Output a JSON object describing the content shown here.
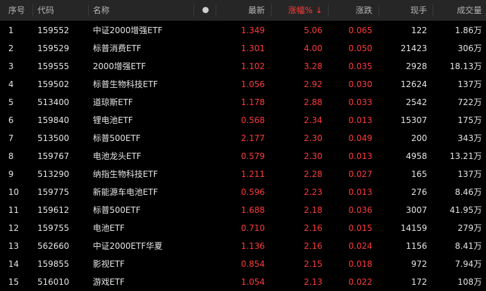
{
  "colors": {
    "header_bg": "#262626",
    "background": "#000000",
    "up": "#ff3b3b",
    "text": "#e6e6e6",
    "header_text": "#b4b4b4"
  },
  "header": {
    "index": "序号",
    "code": "代码",
    "name": "名称",
    "dot_icon": "circle-icon",
    "latest": "最新",
    "change_pct": "涨幅%",
    "sort_icon": "↓",
    "change": "涨跌",
    "volume_hand": "现手",
    "turnover": "成交量"
  },
  "rows": [
    {
      "index": "1",
      "code": "159552",
      "name": "中证2000增强ETF",
      "latest": "1.349",
      "pct": "5.06",
      "chg": "0.065",
      "hand": "122",
      "amount": "1.86万"
    },
    {
      "index": "2",
      "code": "159529",
      "name": "标普消费ETF",
      "latest": "1.301",
      "pct": "4.00",
      "chg": "0.050",
      "hand": "21423",
      "amount": "306万"
    },
    {
      "index": "3",
      "code": "159555",
      "name": "2000增强ETF",
      "latest": "1.102",
      "pct": "3.28",
      "chg": "0.035",
      "hand": "2928",
      "amount": "18.13万"
    },
    {
      "index": "4",
      "code": "159502",
      "name": "标普生物科技ETF",
      "latest": "1.056",
      "pct": "2.92",
      "chg": "0.030",
      "hand": "12624",
      "amount": "137万"
    },
    {
      "index": "5",
      "code": "513400",
      "name": "道琼斯ETF",
      "latest": "1.178",
      "pct": "2.88",
      "chg": "0.033",
      "hand": "2542",
      "amount": "722万"
    },
    {
      "index": "6",
      "code": "159840",
      "name": "锂电池ETF",
      "latest": "0.568",
      "pct": "2.34",
      "chg": "0.013",
      "hand": "15307",
      "amount": "175万"
    },
    {
      "index": "7",
      "code": "513500",
      "name": "标普500ETF",
      "latest": "2.177",
      "pct": "2.30",
      "chg": "0.049",
      "hand": "200",
      "amount": "343万"
    },
    {
      "index": "8",
      "code": "159767",
      "name": "电池龙头ETF",
      "latest": "0.579",
      "pct": "2.30",
      "chg": "0.013",
      "hand": "4958",
      "amount": "13.21万"
    },
    {
      "index": "9",
      "code": "513290",
      "name": "纳指生物科技ETF",
      "latest": "1.211",
      "pct": "2.28",
      "chg": "0.027",
      "hand": "165",
      "amount": "137万"
    },
    {
      "index": "10",
      "code": "159775",
      "name": "新能源车电池ETF",
      "latest": "0.596",
      "pct": "2.23",
      "chg": "0.013",
      "hand": "276",
      "amount": "8.46万"
    },
    {
      "index": "11",
      "code": "159612",
      "name": "标普500ETF",
      "latest": "1.688",
      "pct": "2.18",
      "chg": "0.036",
      "hand": "3007",
      "amount": "41.95万"
    },
    {
      "index": "12",
      "code": "159755",
      "name": "电池ETF",
      "latest": "0.710",
      "pct": "2.16",
      "chg": "0.015",
      "hand": "14159",
      "amount": "279万"
    },
    {
      "index": "13",
      "code": "562660",
      "name": "中证2000ETF华夏",
      "latest": "1.136",
      "pct": "2.16",
      "chg": "0.024",
      "hand": "1156",
      "amount": "8.41万"
    },
    {
      "index": "14",
      "code": "159855",
      "name": "影视ETF",
      "latest": "0.854",
      "pct": "2.15",
      "chg": "0.018",
      "hand": "972",
      "amount": "7.94万"
    },
    {
      "index": "15",
      "code": "516010",
      "name": "游戏ETF",
      "latest": "1.054",
      "pct": "2.13",
      "chg": "0.022",
      "hand": "172",
      "amount": "108万"
    }
  ]
}
